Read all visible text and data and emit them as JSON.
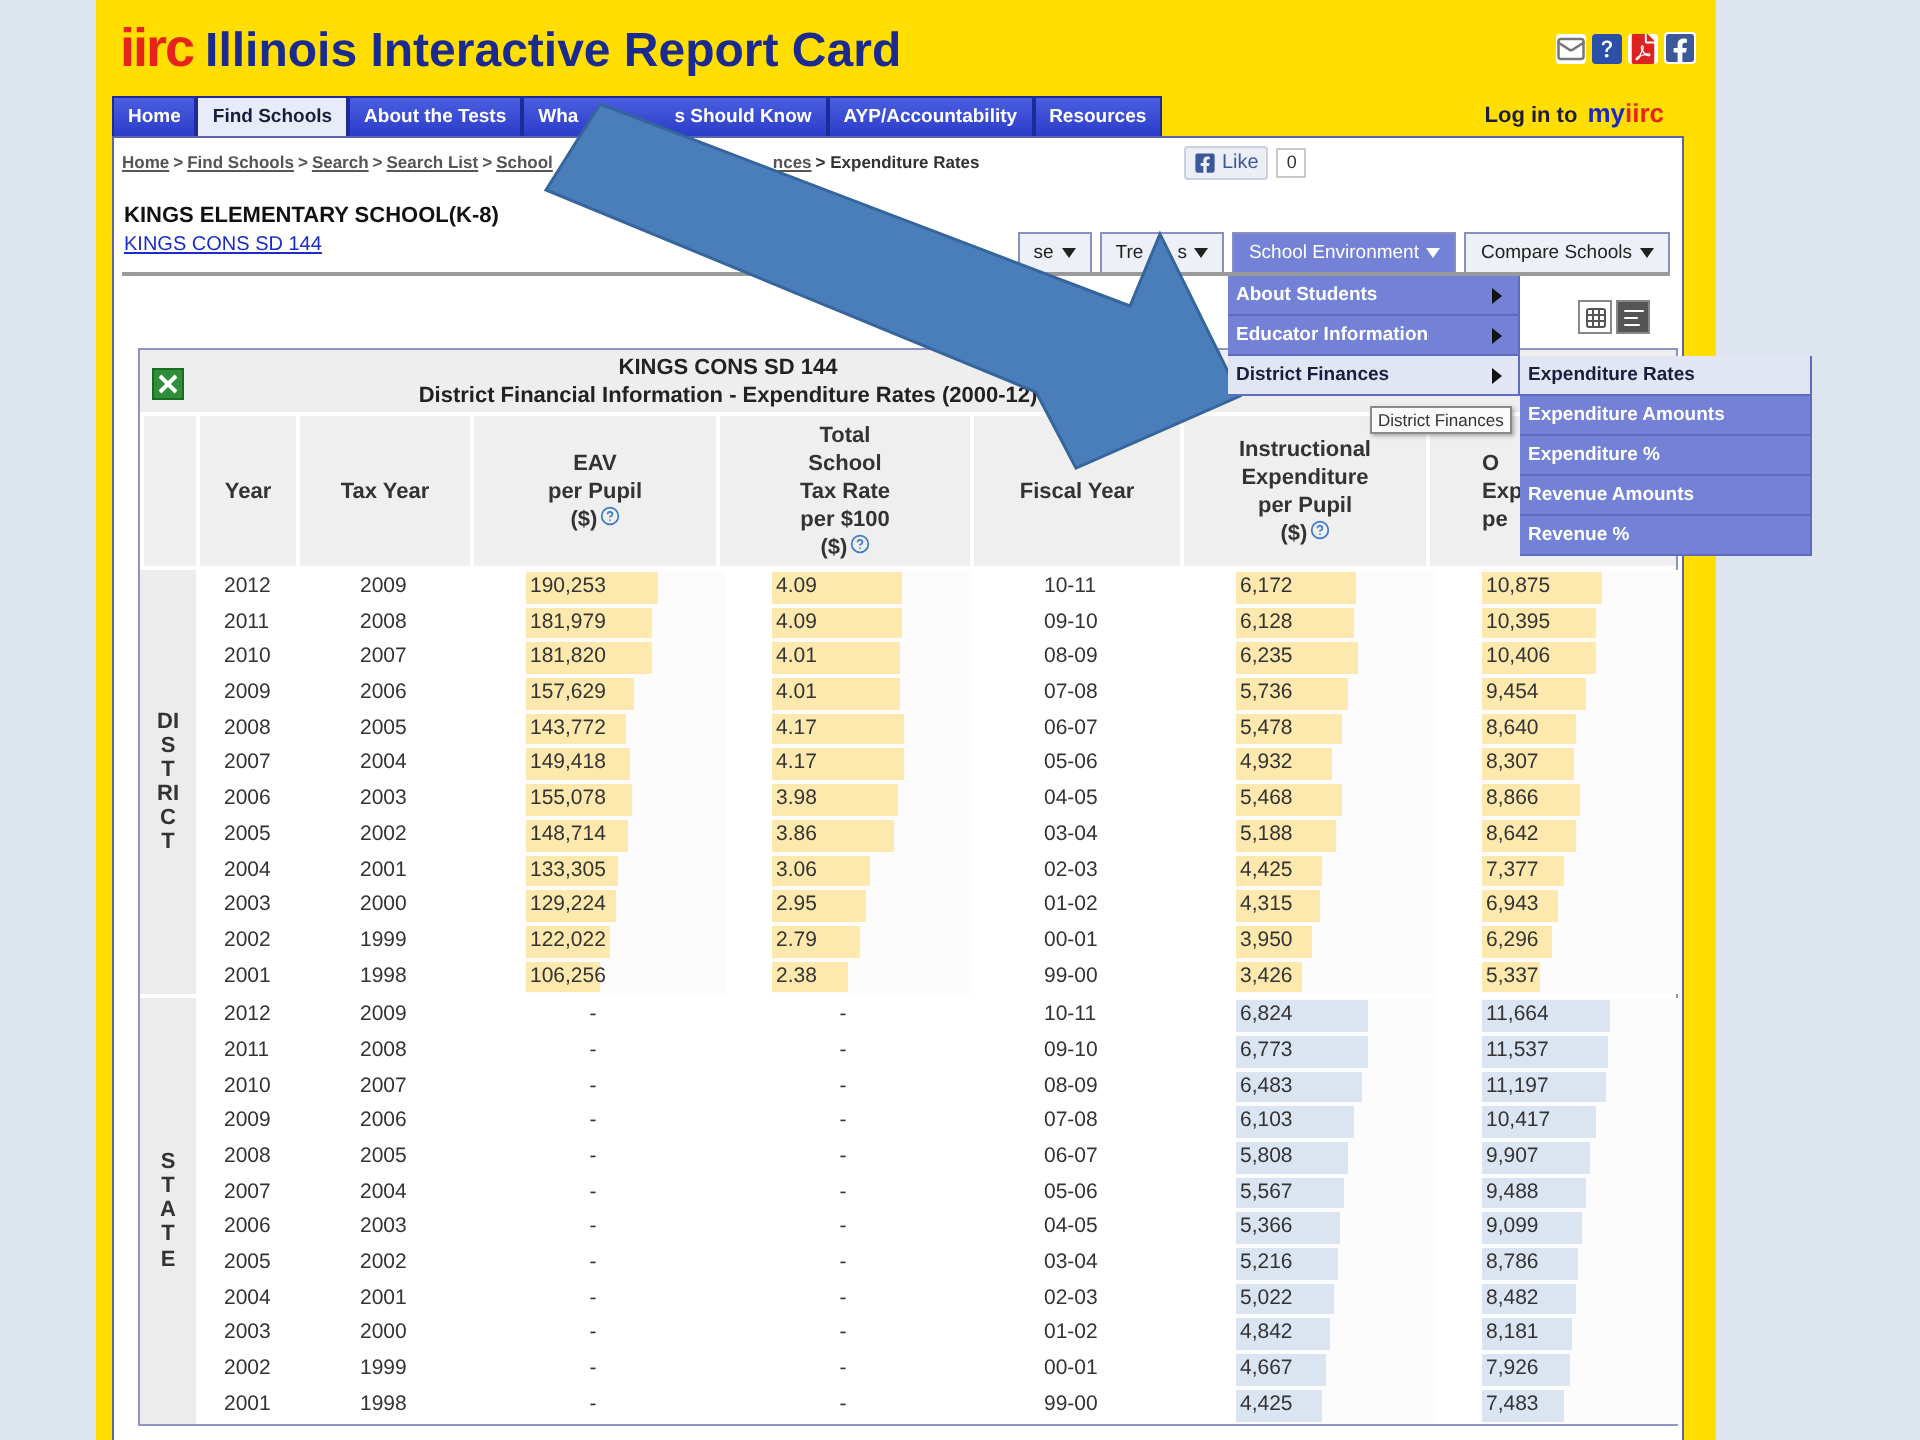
{
  "header": {
    "logo_mark": "iirc",
    "title": "Illinois Interactive Report Card"
  },
  "nav": {
    "tabs": [
      {
        "label": "Home",
        "selected": false
      },
      {
        "label": "Find Schools",
        "selected": true
      },
      {
        "label": "About the Tests",
        "selected": false
      },
      {
        "label": "Wha",
        "label_end": "s Should Know",
        "selected": false
      },
      {
        "label": "AYP/Accountability",
        "selected": false
      },
      {
        "label": "Resources",
        "selected": false
      }
    ],
    "login": {
      "text": "Log in to",
      "brand_my": "my",
      "brand_mark": "iirc"
    }
  },
  "breadcrumb": {
    "links": [
      "Home",
      "Find Schools",
      "Search",
      "Search List",
      "School"
    ],
    "tail_link": "nces",
    "current": "> Expenditure Rates",
    "separator": ">"
  },
  "like": {
    "label": "Like",
    "count": "0"
  },
  "school": {
    "name": "KINGS ELEMENTARY SCHOOL(K-8)",
    "district_link": "KINGS CONS SD 144"
  },
  "section_buttons": [
    {
      "label": "se",
      "selected": false
    },
    {
      "label": "Tre",
      "label_end": "s",
      "selected": false
    },
    {
      "label": "School Environment",
      "selected": true
    },
    {
      "label": "Compare Schools",
      "selected": false
    }
  ],
  "menu": {
    "items": [
      {
        "label": "About Students",
        "selected": false
      },
      {
        "label": "Educator Information",
        "selected": false
      },
      {
        "label": "District Finances",
        "selected": true
      }
    ],
    "submenu": [
      {
        "label": "Expenditure Rates",
        "selected": true
      },
      {
        "label": "Expenditure Amounts",
        "selected": false
      },
      {
        "label": "Expenditure %",
        "selected": false
      },
      {
        "label": "Revenue Amounts",
        "selected": false
      },
      {
        "label": "Revenue %",
        "selected": false
      }
    ],
    "tooltip": "District Finances"
  },
  "table": {
    "title": "KINGS CONS SD 144",
    "subtitle": "District Financial Information - Expenditure Rates (2000-12)",
    "columns": [
      {
        "lines": [
          "Year"
        ],
        "help": false
      },
      {
        "lines": [
          "Tax Year"
        ],
        "help": false
      },
      {
        "lines": [
          "EAV",
          "per Pupil",
          "($)"
        ],
        "help": true
      },
      {
        "lines": [
          "Total",
          "School",
          "Tax Rate",
          "per $100",
          "($)"
        ],
        "help": true
      },
      {
        "lines": [
          "Fiscal Year"
        ],
        "help": false
      },
      {
        "lines": [
          "Instructional",
          "Expenditure",
          "per Pupil",
          "($)"
        ],
        "help": true
      },
      {
        "lines": [
          "O",
          "Exp",
          "pe"
        ],
        "help": false
      }
    ],
    "groups": [
      {
        "label": "DISTRICT",
        "kind": "district",
        "rows": [
          {
            "year": "2012",
            "tax_year": "2009",
            "eav": {
              "text": "190,253",
              "level": 0.66
            },
            "tax_rate": {
              "text": "4.09",
              "level": 0.65
            },
            "fiscal_year": "10-11",
            "instructional": {
              "text": "6,172",
              "level": 0.6
            },
            "column_7": {
              "text": "10,875",
              "level": 0.6
            }
          },
          {
            "year": "2011",
            "tax_year": "2008",
            "eav": {
              "text": "181,979",
              "level": 0.63
            },
            "tax_rate": {
              "text": "4.09",
              "level": 0.65
            },
            "fiscal_year": "09-10",
            "instructional": {
              "text": "6,128",
              "level": 0.59
            },
            "column_7": {
              "text": "10,395",
              "level": 0.57
            }
          },
          {
            "year": "2010",
            "tax_year": "2007",
            "eav": {
              "text": "181,820",
              "level": 0.63
            },
            "tax_rate": {
              "text": "4.01",
              "level": 0.64
            },
            "fiscal_year": "08-09",
            "instructional": {
              "text": "6,235",
              "level": 0.61
            },
            "column_7": {
              "text": "10,406",
              "level": 0.57
            }
          },
          {
            "year": "2009",
            "tax_year": "2006",
            "eav": {
              "text": "157,629",
              "level": 0.54
            },
            "tax_rate": {
              "text": "4.01",
              "level": 0.64
            },
            "fiscal_year": "07-08",
            "instructional": {
              "text": "5,736",
              "level": 0.56
            },
            "column_7": {
              "text": "9,454",
              "level": 0.52
            }
          },
          {
            "year": "2008",
            "tax_year": "2005",
            "eav": {
              "text": "143,772",
              "level": 0.5
            },
            "tax_rate": {
              "text": "4.17",
              "level": 0.66
            },
            "fiscal_year": "06-07",
            "instructional": {
              "text": "5,478",
              "level": 0.53
            },
            "column_7": {
              "text": "8,640",
              "level": 0.47
            }
          },
          {
            "year": "2007",
            "tax_year": "2004",
            "eav": {
              "text": "149,418",
              "level": 0.52
            },
            "tax_rate": {
              "text": "4.17",
              "level": 0.66
            },
            "fiscal_year": "05-06",
            "instructional": {
              "text": "4,932",
              "level": 0.48
            },
            "column_7": {
              "text": "8,307",
              "level": 0.46
            }
          },
          {
            "year": "2006",
            "tax_year": "2003",
            "eav": {
              "text": "155,078",
              "level": 0.53
            },
            "tax_rate": {
              "text": "3.98",
              "level": 0.63
            },
            "fiscal_year": "04-05",
            "instructional": {
              "text": "5,468",
              "level": 0.53
            },
            "column_7": {
              "text": "8,866",
              "level": 0.49
            }
          },
          {
            "year": "2005",
            "tax_year": "2002",
            "eav": {
              "text": "148,714",
              "level": 0.51
            },
            "tax_rate": {
              "text": "3.86",
              "level": 0.61
            },
            "fiscal_year": "03-04",
            "instructional": {
              "text": "5,188",
              "level": 0.5
            },
            "column_7": {
              "text": "8,642",
              "level": 0.47
            }
          },
          {
            "year": "2004",
            "tax_year": "2001",
            "eav": {
              "text": "133,305",
              "level": 0.46
            },
            "tax_rate": {
              "text": "3.06",
              "level": 0.49
            },
            "fiscal_year": "02-03",
            "instructional": {
              "text": "4,425",
              "level": 0.43
            },
            "column_7": {
              "text": "7,377",
              "level": 0.41
            }
          },
          {
            "year": "2003",
            "tax_year": "2000",
            "eav": {
              "text": "129,224",
              "level": 0.45
            },
            "tax_rate": {
              "text": "2.95",
              "level": 0.47
            },
            "fiscal_year": "01-02",
            "instructional": {
              "text": "4,315",
              "level": 0.42
            },
            "column_7": {
              "text": "6,943",
              "level": 0.38
            }
          },
          {
            "year": "2002",
            "tax_year": "1999",
            "eav": {
              "text": "122,022",
              "level": 0.42
            },
            "tax_rate": {
              "text": "2.79",
              "level": 0.44
            },
            "fiscal_year": "00-01",
            "instructional": {
              "text": "3,950",
              "level": 0.38
            },
            "column_7": {
              "text": "6,296",
              "level": 0.35
            }
          },
          {
            "year": "2001",
            "tax_year": "1998",
            "eav": {
              "text": "106,256",
              "level": 0.37
            },
            "tax_rate": {
              "text": "2.38",
              "level": 0.38
            },
            "fiscal_year": "99-00",
            "instructional": {
              "text": "3,426",
              "level": 0.33
            },
            "column_7": {
              "text": "5,337",
              "level": 0.29
            }
          }
        ]
      },
      {
        "label": "STATE",
        "kind": "state",
        "rows": [
          {
            "year": "2012",
            "tax_year": "2009",
            "eav": {
              "text": "-"
            },
            "tax_rate": {
              "text": "-"
            },
            "fiscal_year": "10-11",
            "instructional": {
              "text": "6,824",
              "level": 0.66
            },
            "column_7": {
              "text": "11,664",
              "level": 0.64
            }
          },
          {
            "year": "2011",
            "tax_year": "2008",
            "eav": {
              "text": "-"
            },
            "tax_rate": {
              "text": "-"
            },
            "fiscal_year": "09-10",
            "instructional": {
              "text": "6,773",
              "level": 0.66
            },
            "column_7": {
              "text": "11,537",
              "level": 0.63
            }
          },
          {
            "year": "2010",
            "tax_year": "2007",
            "eav": {
              "text": "-"
            },
            "tax_rate": {
              "text": "-"
            },
            "fiscal_year": "08-09",
            "instructional": {
              "text": "6,483",
              "level": 0.63
            },
            "column_7": {
              "text": "11,197",
              "level": 0.62
            }
          },
          {
            "year": "2009",
            "tax_year": "2006",
            "eav": {
              "text": "-"
            },
            "tax_rate": {
              "text": "-"
            },
            "fiscal_year": "07-08",
            "instructional": {
              "text": "6,103",
              "level": 0.59
            },
            "column_7": {
              "text": "10,417",
              "level": 0.57
            }
          },
          {
            "year": "2008",
            "tax_year": "2005",
            "eav": {
              "text": "-"
            },
            "tax_rate": {
              "text": "-"
            },
            "fiscal_year": "06-07",
            "instructional": {
              "text": "5,808",
              "level": 0.56
            },
            "column_7": {
              "text": "9,907",
              "level": 0.54
            }
          },
          {
            "year": "2007",
            "tax_year": "2004",
            "eav": {
              "text": "-"
            },
            "tax_rate": {
              "text": "-"
            },
            "fiscal_year": "05-06",
            "instructional": {
              "text": "5,567",
              "level": 0.54
            },
            "column_7": {
              "text": "9,488",
              "level": 0.52
            }
          },
          {
            "year": "2006",
            "tax_year": "2003",
            "eav": {
              "text": "-"
            },
            "tax_rate": {
              "text": "-"
            },
            "fiscal_year": "04-05",
            "instructional": {
              "text": "5,366",
              "level": 0.52
            },
            "column_7": {
              "text": "9,099",
              "level": 0.5
            }
          },
          {
            "year": "2005",
            "tax_year": "2002",
            "eav": {
              "text": "-"
            },
            "tax_rate": {
              "text": "-"
            },
            "fiscal_year": "03-04",
            "instructional": {
              "text": "5,216",
              "level": 0.51
            },
            "column_7": {
              "text": "8,786",
              "level": 0.48
            }
          },
          {
            "year": "2004",
            "tax_year": "2001",
            "eav": {
              "text": "-"
            },
            "tax_rate": {
              "text": "-"
            },
            "fiscal_year": "02-03",
            "instructional": {
              "text": "5,022",
              "level": 0.49
            },
            "column_7": {
              "text": "8,482",
              "level": 0.47
            }
          },
          {
            "year": "2003",
            "tax_year": "2000",
            "eav": {
              "text": "-"
            },
            "tax_rate": {
              "text": "-"
            },
            "fiscal_year": "01-02",
            "instructional": {
              "text": "4,842",
              "level": 0.47
            },
            "column_7": {
              "text": "8,181",
              "level": 0.45
            }
          },
          {
            "year": "2002",
            "tax_year": "1999",
            "eav": {
              "text": "-"
            },
            "tax_rate": {
              "text": "-"
            },
            "fiscal_year": "00-01",
            "instructional": {
              "text": "4,667",
              "level": 0.45
            },
            "column_7": {
              "text": "7,926",
              "level": 0.44
            }
          },
          {
            "year": "2001",
            "tax_year": "1998",
            "eav": {
              "text": "-"
            },
            "tax_rate": {
              "text": "-"
            },
            "fiscal_year": "99-00",
            "instructional": {
              "text": "4,425",
              "level": 0.43
            },
            "column_7": {
              "text": "7,483",
              "level": 0.41
            }
          }
        ]
      }
    ]
  }
}
